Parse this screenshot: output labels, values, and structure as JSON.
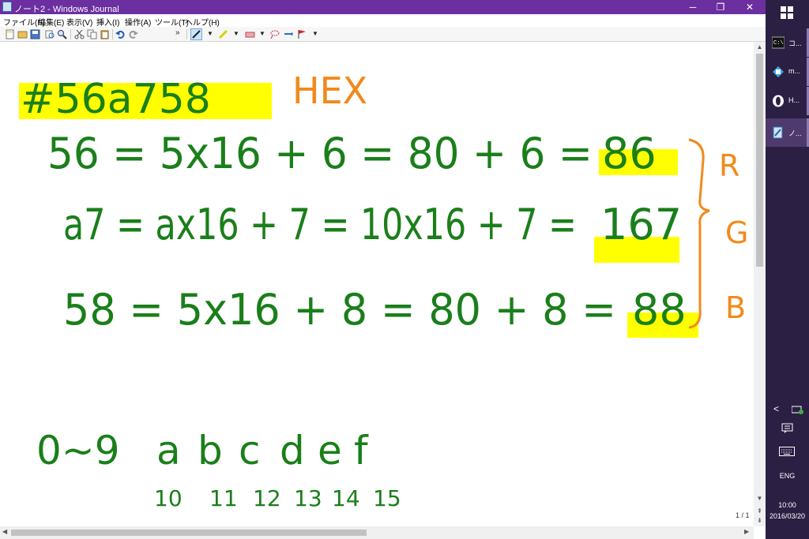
{
  "window": {
    "title": "ノート2 - Windows Journal",
    "controls": {
      "minimize": "─",
      "restore": "❐",
      "close": "✕"
    }
  },
  "menu": [
    "ファイル(F)",
    "編集(E)",
    "表示(V)",
    "挿入(I)",
    "操作(A)",
    "ツール(T)",
    "ヘルプ(H)"
  ],
  "toolbar": {
    "overflow": "»",
    "icons": [
      "new-note-icon",
      "open-icon",
      "save-icon",
      "print-preview-icon",
      "find-icon",
      "cut-icon",
      "copy-icon",
      "paste-icon",
      "undo-icon",
      "redo-icon",
      "pen-icon",
      "highlighter-icon",
      "eraser-icon",
      "lasso-select-icon",
      "insert-space-icon",
      "flag-icon"
    ]
  },
  "note": {
    "ink_color": "#1a7f1a",
    "highlight_color": "#ffff00",
    "accent_color": "#f08a1c",
    "hex_code": "#56a758",
    "hex_label": "HEX",
    "lines": [
      {
        "text": "56 = 5x16 + 6 = 80 + 6 =",
        "result": "86",
        "channel": "R"
      },
      {
        "text": "a7 = ax16 + 7 = 10x16 + 7 =",
        "result": "167",
        "channel": "G"
      },
      {
        "text": "58 = 5x16 + 8 = 80 + 8 =",
        "result": "88",
        "channel": "B"
      }
    ],
    "digits_label": "0~9",
    "letters": [
      "a",
      "b",
      "c",
      "d",
      "e",
      "f"
    ],
    "letter_values": [
      "10",
      "11",
      "12",
      "13",
      "14",
      "15"
    ]
  },
  "page_counter": "1 / 1",
  "taskbar": {
    "items": [
      {
        "label": "コ...",
        "icon": "command-prompt-icon"
      },
      {
        "label": "m...",
        "icon": "app-m-icon"
      },
      {
        "label": "H...",
        "icon": "opera-icon"
      },
      {
        "label": "ノ...",
        "icon": "journal-icon"
      }
    ],
    "chevron": "<",
    "language": "ENG",
    "time": "10:00",
    "date": "2016/03/20"
  }
}
